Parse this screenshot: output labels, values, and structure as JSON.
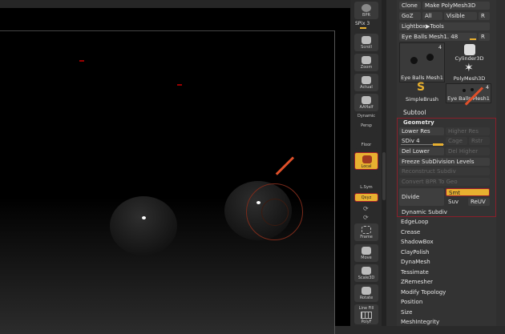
{
  "shelf": {
    "bpr": "BPR",
    "spix": "SPix 3",
    "buttons": [
      "Scroll",
      "Zoom",
      "Actual",
      "AAHalf",
      "Persp",
      "Floor",
      "Local",
      "L.Sym",
      "Qxyz",
      "Frame",
      "Move",
      "Scale3D",
      "Rotate",
      "PolyF"
    ],
    "dynamic": "Dynamic",
    "linefill": "Line Fill"
  },
  "tool": {
    "clone": "Clone",
    "make_polymesh": "Make PolyMesh3D",
    "goz": "GoZ",
    "all": "All",
    "visible": "Visible",
    "r": "R",
    "lightbox": "Lightbox▶Tools",
    "current_tool": "Eye Balls Mesh1. 48",
    "r2": "R",
    "thumbs": [
      {
        "label": "Eye Balls Mesh1",
        "count": "4"
      },
      {
        "label": "Cylinder3D"
      },
      {
        "label": "PolyMesh3D"
      },
      {
        "label": "SimpleBrush"
      },
      {
        "label": "Eye Balls Mesh1",
        "count": "4"
      }
    ]
  },
  "subtool": "Subtool",
  "geometry": {
    "title": "Geometry",
    "lower_res": "Lower Res",
    "higher_res": "Higher Res",
    "sdiv": "SDiv 4",
    "sdiv_value": 4,
    "cage": "Cage",
    "rstr": "Rstr",
    "del_lower": "Del Lower",
    "del_higher": "Del Higher",
    "freeze": "Freeze SubDivision Levels",
    "reconstruct": "Reconstruct Subdiv",
    "convert": "Convert BPR To Geo",
    "divide": "Divide",
    "smt": "Smt",
    "suv": "Suv",
    "reuv": "ReUV",
    "dynamic_subdiv": "Dynamic Subdiv"
  },
  "sections": [
    "EdgeLoop",
    "Crease",
    "ShadowBox",
    "ClayPolish",
    "DynaMesh",
    "Tessimate",
    "ZRemesher",
    "Modify Topology",
    "Position",
    "Size",
    "MeshIntegrity"
  ],
  "colors": {
    "accent": "#e8b030",
    "highlight": "#9a1d2a",
    "annotation": "#e0502a"
  }
}
